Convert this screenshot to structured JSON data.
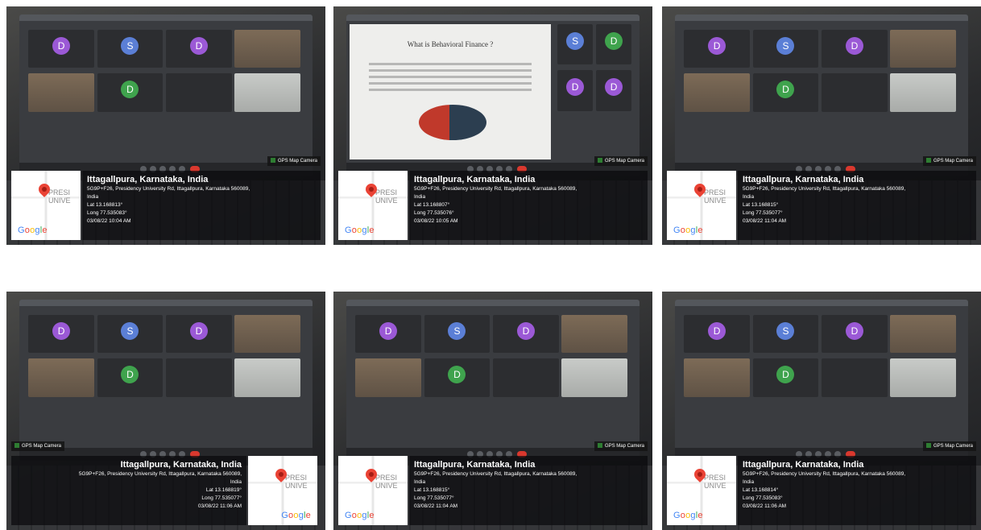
{
  "photos": [
    {
      "scene": "grid",
      "gps_tag": "GPS Map Camera",
      "map_place": "PRESI\nUNIVE",
      "google": "Google",
      "location_title": "Ittagallpura, Karnataka, India",
      "address": "5G9P+F26, Presidency University Rd, Ittagallpura, Karnataka 560089,",
      "country": "India",
      "lat": "Lat 13.168813°",
      "long": "Long 77.535083°",
      "datetime": "03/08/22 10:04 AM"
    },
    {
      "scene": "slide",
      "slide_title": "What is Behavioral Finance ?",
      "gps_tag": "GPS Map Camera",
      "map_place": "PRESI\nUNIVE",
      "google": "Google",
      "location_title": "Ittagallpura, Karnataka, India",
      "address": "5G9P+F26, Presidency University Rd, Ittagallpura, Karnataka 560089,",
      "country": "India",
      "lat": "Lat 13.168807°",
      "long": "Long 77.535076°",
      "datetime": "03/08/22 10:05 AM"
    },
    {
      "scene": "grid",
      "gps_tag": "GPS Map Camera",
      "map_place": "PRESI\nUNIVE",
      "google": "Google",
      "location_title": "Ittagallpura, Karnataka, India",
      "address": "5G9P+F26, Presidency University Rd, Ittagallpura, Karnataka 560089,",
      "country": "India",
      "lat": "Lat 13.168815°",
      "long": "Long 77.535077°",
      "datetime": "03/08/22 11:04 AM"
    },
    {
      "scene": "grid",
      "mirrored": true,
      "gps_tag": "GPS Map Camera",
      "map_place": "PRESI\nUNIVE",
      "google": "Google",
      "location_title": "Ittagallpura, Karnataka, India",
      "address": "5G9P+F26, Presidency University Rd, Ittagallpura, Karnataka 560089,",
      "country": "India",
      "lat": "Lat 13.168819°",
      "long": "Long 77.535077°",
      "datetime": "03/08/22 11:06 AM"
    },
    {
      "scene": "grid",
      "gps_tag": "GPS Map Camera",
      "map_place": "PRESI\nUNIVE",
      "google": "Google",
      "location_title": "Ittagallpura, Karnataka, India",
      "address": "5G9P+F26, Presidency University Rd, Ittagallpura, Karnataka 560089,",
      "country": "India",
      "lat": "Lat 13.168815°",
      "long": "Long 77.535077°",
      "datetime": "03/08/22 11:04 AM"
    },
    {
      "scene": "grid",
      "gps_tag": "GPS Map Camera",
      "map_place": "PRESI\nUNIVE",
      "google": "Google",
      "location_title": "Ittagallpura, Karnataka, India",
      "address": "5G9P+F26, Presidency University Rd, Ittagallpura, Karnataka 560089,",
      "country": "India",
      "lat": "Lat 13.168814°",
      "long": "Long 77.535083°",
      "datetime": "03/08/22 11:06 AM"
    }
  ],
  "colors": {
    "map_pin": "#ea4335",
    "gps_icon": "#2e7d32",
    "avatar_blue": "#5b7fd6",
    "avatar_green": "#3fa34d",
    "avatar_purple": "#9b59d6",
    "avatar_teal": "#3c9c9a",
    "hangup_red": "#d9382e"
  },
  "icons": {
    "map": "map-pin-icon",
    "gps": "gps-camera-icon"
  }
}
